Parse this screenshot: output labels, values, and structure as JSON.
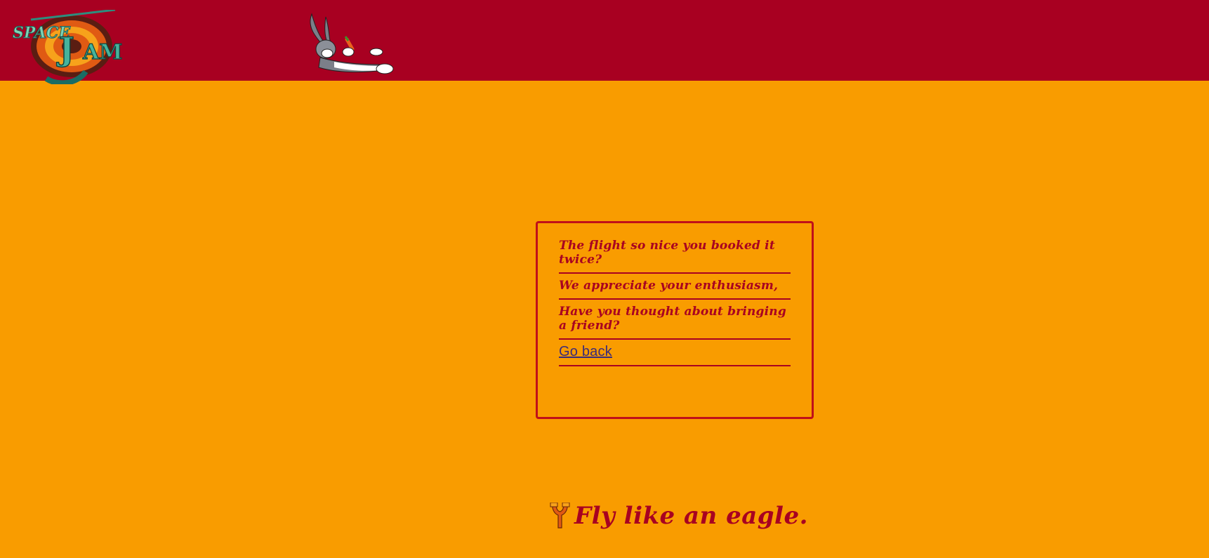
{
  "header": {
    "logo": {
      "text": "SPACE JAM",
      "icon": "space-jam-logo"
    },
    "mascot": {
      "icon": "bugs-bunny-lounging"
    }
  },
  "card": {
    "lines": [
      "The flight so nice you booked it twice?",
      "We appreciate your enthusiasm,",
      "Have you thought about bringing a friend?"
    ],
    "link_label": "Go back"
  },
  "footer": {
    "icon": "slingshot-icon",
    "text": "Fly like an eagle."
  },
  "colors": {
    "header_bg": "#a80021",
    "page_bg": "#f99c00",
    "accent": "#a80021",
    "link": "#3b2b7a"
  }
}
